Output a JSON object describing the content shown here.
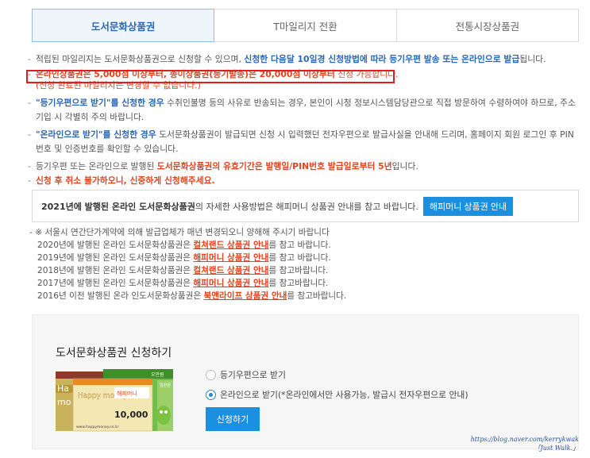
{
  "tabs": [
    {
      "label": "도서문화상품권",
      "active": true
    },
    {
      "label": "T마일리지 전환",
      "active": false
    },
    {
      "label": "전통시장상품권",
      "active": false
    }
  ],
  "notes": {
    "n1_a": "적립된 마일리지는 도서문화상품권으로 신청할 수 있으며, ",
    "n1_b": "신청한 다음달 10일경 신청방법에 따라 등기우편 발송 또는 온라인으로 발급",
    "n1_c": "됩니다.",
    "n2": "온라인상품권은 5,000점 이상부터, 종이상품권(등기발송)은 20,000점 이상부터",
    "n2_tail": " 신청 가능합니다.",
    "n2_sub": "(신청 완료된 마일리지는 변경할 수 없습니다.)",
    "n3_a": "\"등기우편으로 받기\"를 신청한 경우",
    "n3_b": " 수취인불명 등의 사유로 반송되는 경우, 본인이 시청 정보시스템담당관으로 직접 방문하여 수령하여야 하므로, 주소 기입 시 각별히 주의 바랍니다.",
    "n4_a": "\"온라인으로 받기\"를 신청한 경우",
    "n4_b": " 도서문화상품권이 발급되면 신청 시 입력했던 전자우편으로 발급사실을 안내해 드리며, 홈페이지 회원 로그인 후 PIN번호 및 인증번호를 확인할 수 있습니다.",
    "n5_a": "등기우편 또는 온라인으로 발행된 ",
    "n5_b": "도서문화상품권의 유효기간은 발행일/PIN번호 발급일로부터 5년",
    "n5_c": "입니다.",
    "n6": "신청 후 취소 불가하오니, 신중하게 신청해주세요."
  },
  "info": {
    "text_a": "2021년에 발행된 온라인 도서문화상품권",
    "text_b": "의 자세한 사용방법은 해피머니 상품권 안내를 참고 바랍니다.",
    "button": "해피머니 상품권 안내"
  },
  "history": {
    "intro": "- ※ 서울시 연간단가계약에 의해 발급업체가 매년 변경되오니 양해해 주시기 바랍니다",
    "rows": [
      {
        "pre": "2020년에 발행된 온라인 도서문화상품권은 ",
        "link": "컬쳐랜드 상품권 안내",
        "post": "를 참고 바랍니다."
      },
      {
        "pre": "2019년에 발행된 온라인 도서문화상품권은 ",
        "link": "해피머니 상품권 안내",
        "post": "를 참고 바랍니다."
      },
      {
        "pre": "2018년에 발행된 온라인 도서문화상품권은 ",
        "link": "컬쳐랜드 상품권 안내",
        "post": "를 참고바랍니다."
      },
      {
        "pre": "2017년에 발행된 온라인 도서문화상품권은 ",
        "link": "해피머니 상품권 안내",
        "post": "를 참고바랍니다."
      },
      {
        "pre": "2016년 이전 발행된 온라 인도서문화상품권은 ",
        "link": "북앤라이프 상품권 안내",
        "post": "를 참고바랍니다."
      }
    ]
  },
  "apply": {
    "title": "도서문화상품권 신청하기",
    "option_mail": "등기우편으로 받기",
    "option_online": "온라인으로 받기(*온라인에서만 사용가능, 발급시 전자우편으로 안내)",
    "selected": "online",
    "button": "신청하기",
    "voucher": {
      "brand": "Happy money",
      "brand_kr": "해피머니",
      "amount": "10,000",
      "url": "www.happymoney.co.kr",
      "tag_left": "Ha",
      "tag_left2": "mo",
      "corner": "오만원",
      "corner2": "일만원"
    }
  },
  "watermark": {
    "line1": "https://blog.naver.com/kerrykwak",
    "line2": "「Just Walk.」"
  },
  "colors": {
    "accent": "#1b8fe0",
    "highlight": "#e8411b",
    "emphasis": "#2a67b6"
  }
}
